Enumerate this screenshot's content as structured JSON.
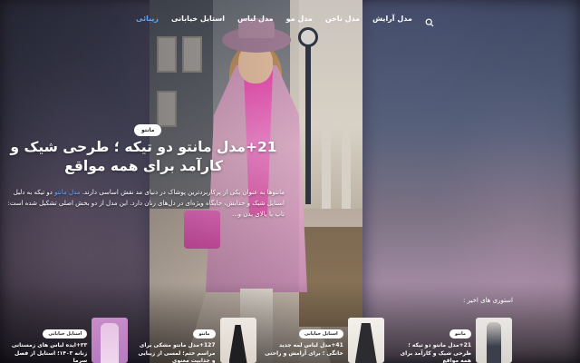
{
  "nav": {
    "items": [
      {
        "label": "زیبائی",
        "active": true
      },
      {
        "label": "استایل خیابانی",
        "active": false
      },
      {
        "label": "مدل لباس",
        "active": false
      },
      {
        "label": "مدل مو",
        "active": false
      },
      {
        "label": "مدل ناخن",
        "active": false
      },
      {
        "label": "مدل آرایش",
        "active": false
      }
    ],
    "search_icon": "search-icon"
  },
  "hero": {
    "category": "مانتو",
    "title": "21+مدل مانتو دو تیکه ؛ طرحی شیک و کارآمد برای همه مواقع",
    "excerpt_before": "مانتوها به عنوان یکی از پرکاربردترین پوشاک در دنیای مد نقش اساسی دارند.",
    "excerpt_link": "مدل مانتو",
    "excerpt_after": "دو تیکه به دلیل استایل شیک و جذابش، جایگاه ویژه‌ای در دل‌های زنان دارد. این مدل از دو بخش اصلی تشکیل شده است: تاپ یا بالای بدن و..."
  },
  "stories": {
    "label": "استوری های اخیر :",
    "items": [
      {
        "category": "مانتو",
        "title": "21+مدل مانتو دو تیکه ؛ طرحی شیک و کارآمد برای همه مواقع"
      },
      {
        "category": "استایل خیابانی",
        "title": "41+مدل لباس لمه جدید خانگی ؛ برای آرامش و راحتی"
      },
      {
        "category": "مانتو",
        "title": "127+مدل مانتو مشکی برای مراسم ختم؛ لمسی از زیبایی و جذابیت معنوی"
      },
      {
        "category": "استایل خیابانی",
        "title": "۳۳+ایده لباس های زمستانی زنانه ۱۴۰۳؛ استایل از فصل سرما"
      }
    ]
  }
}
